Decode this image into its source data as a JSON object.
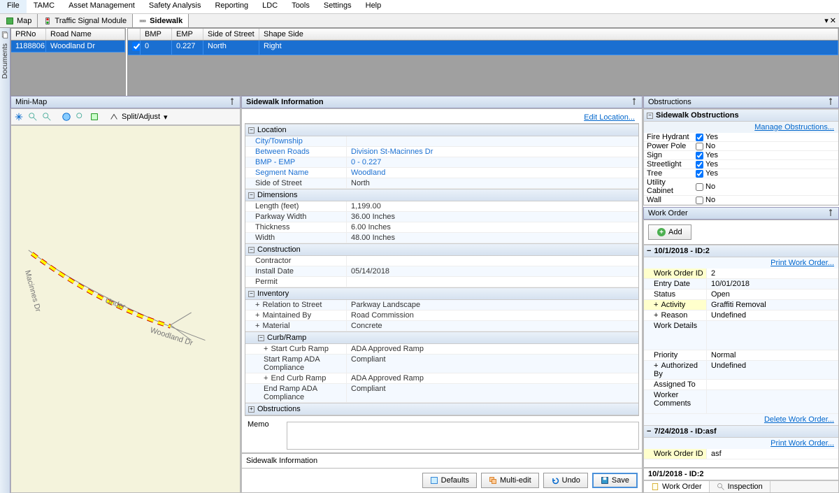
{
  "menubar": [
    "File",
    "TAMC",
    "Asset Management",
    "Safety Analysis",
    "Reporting",
    "LDC",
    "Tools",
    "Settings",
    "Help"
  ],
  "tabs": [
    {
      "label": "Map"
    },
    {
      "label": "Traffic Signal Module"
    },
    {
      "label": "Sidewalk",
      "active": true
    }
  ],
  "road_grid": {
    "headers": [
      "PRNo",
      "Road Name"
    ],
    "row": {
      "prno": "1188806",
      "name": "Woodland Dr"
    }
  },
  "segment_grid": {
    "headers": [
      "",
      "BMP",
      "EMP",
      "Side of Street",
      "Shape Side"
    ],
    "widths": [
      18,
      45,
      45,
      80,
      820
    ],
    "row": {
      "checked": true,
      "bmp": "0",
      "emp": "0.227",
      "side": "North",
      "shape": "Right"
    }
  },
  "minimap": {
    "title": "Mini-Map",
    "split_label": "Split/Adjust",
    "labels": {
      "macinnes": "Macinnes Dr",
      "under": "Under",
      "woodland": "Woodland Dr"
    }
  },
  "sidewalk_info": {
    "title": "Sidewalk Information",
    "edit_location": "Edit Location...",
    "groups": {
      "location": {
        "title": "Location",
        "rows": [
          {
            "label": "City/Township",
            "value": "",
            "blue": true
          },
          {
            "label": "Between Roads",
            "value": "Division St-Macinnes Dr",
            "blue": true
          },
          {
            "label": "BMP - EMP",
            "value": "0 - 0.227",
            "blue": true
          },
          {
            "label": "Segment Name",
            "value": "Woodland",
            "blue": true
          },
          {
            "label": "Side of Street",
            "value": "North"
          }
        ]
      },
      "dimensions": {
        "title": "Dimensions",
        "rows": [
          {
            "label": "Length (feet)",
            "value": "1,199.00"
          },
          {
            "label": "Parkway Width",
            "value": "36.00 Inches"
          },
          {
            "label": "Thickness",
            "value": "6.00 Inches"
          },
          {
            "label": "Width",
            "value": "48.00 Inches"
          }
        ]
      },
      "construction": {
        "title": "Construction",
        "rows": [
          {
            "label": "Contractor",
            "value": ""
          },
          {
            "label": "Install Date",
            "value": "05/14/2018"
          },
          {
            "label": "Permit",
            "value": ""
          }
        ]
      },
      "inventory": {
        "title": "Inventory",
        "rows": [
          {
            "label": "Relation to Street",
            "value": "Parkway Landscape",
            "exp": true
          },
          {
            "label": "Maintained By",
            "value": "Road Commission",
            "exp": true
          },
          {
            "label": "Material",
            "value": "Concrete",
            "exp": true
          }
        ],
        "curb_ramp": {
          "title": "Curb/Ramp",
          "rows": [
            {
              "label": "Start Curb Ramp",
              "value": "ADA Approved Ramp",
              "exp": true
            },
            {
              "label": "Start Ramp ADA Compliance",
              "value": "Compliant"
            },
            {
              "label": "End Curb Ramp",
              "value": "ADA Approved Ramp",
              "exp": true
            },
            {
              "label": "End Ramp ADA Compliance",
              "value": "Compliant"
            }
          ]
        }
      },
      "obstructions": {
        "title": "Obstructions"
      }
    },
    "memo_label": "Memo",
    "bottom_title": "Sidewalk Information",
    "buttons": {
      "defaults": "Defaults",
      "multiedit": "Multi-edit",
      "undo": "Undo",
      "save": "Save"
    }
  },
  "obstructions_panel": {
    "title": "Obstructions",
    "subtitle": "Sidewalk Obstructions",
    "manage_link": "Manage Obstructions...",
    "rows": [
      {
        "label": "Fire Hydrant",
        "checked": true,
        "value": "Yes"
      },
      {
        "label": "Power Pole",
        "checked": false,
        "value": "No"
      },
      {
        "label": "Sign",
        "checked": true,
        "value": "Yes"
      },
      {
        "label": "Streetlight",
        "checked": true,
        "value": "Yes"
      },
      {
        "label": "Tree",
        "checked": true,
        "value": "Yes"
      },
      {
        "label": "Utility Cabinet",
        "checked": false,
        "value": "No"
      },
      {
        "label": "Wall",
        "checked": false,
        "value": "No"
      }
    ]
  },
  "work_order_panel": {
    "title": "Work Order",
    "add_btn": "Add",
    "order1": {
      "header": "10/1/2018 - ID:2",
      "print_link": "Print Work Order...",
      "rows": [
        {
          "label": "Work Order ID",
          "value": "2",
          "hilite": true
        },
        {
          "label": "Entry Date",
          "value": "10/01/2018"
        },
        {
          "label": "Status",
          "value": "Open"
        },
        {
          "label": "Activity",
          "value": "Graffiti Removal",
          "exp": true,
          "hilite": true
        },
        {
          "label": "Reason",
          "value": "Undefined",
          "exp": true
        },
        {
          "label": "Work Details",
          "value": ""
        },
        {
          "label": "Priority",
          "value": "Normal"
        },
        {
          "label": "Authorized By",
          "value": "Undefined",
          "exp": true
        },
        {
          "label": "Assigned To",
          "value": ""
        },
        {
          "label": "Worker Comments",
          "value": ""
        }
      ],
      "delete_link": "Delete Work Order..."
    },
    "order2": {
      "header": "7/24/2018 - ID:asf",
      "print_link": "Print Work Order...",
      "row": {
        "label": "Work Order ID",
        "value": "asf"
      }
    }
  },
  "bottom_tabs": {
    "title": "10/1/2018 - ID:2",
    "tabs": [
      "Work Order",
      "Inspection"
    ]
  },
  "documents_label": "Documents"
}
